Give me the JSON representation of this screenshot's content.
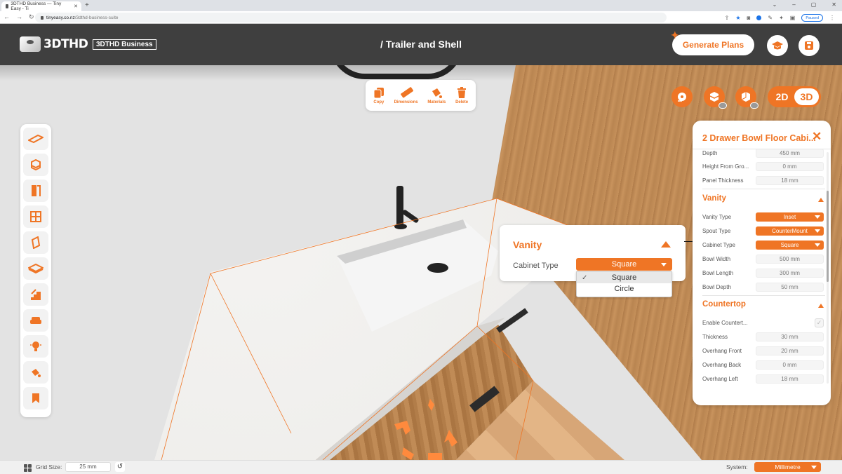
{
  "browser": {
    "tab_title": "3DTHD Business — Tiny Easy - Ti",
    "url_host": "tinyeasy.co.nz",
    "url_path": "/3dthd-business-suite",
    "profile_status": "Paused"
  },
  "header": {
    "logo_text": "3DTHD",
    "badge": "3DTHD Business",
    "page_title": "/ Trailer and Shell",
    "generate_plans": "Generate Plans"
  },
  "object_toolbar": [
    {
      "label": "Copy",
      "icon": "copy-icon"
    },
    {
      "label": "Dimensions",
      "icon": "ruler-icon"
    },
    {
      "label": "Materials",
      "icon": "paint-bucket-icon"
    },
    {
      "label": "Delete",
      "icon": "trash-icon"
    }
  ],
  "view_toggle": {
    "option_2d": "2D",
    "option_3d": "3D",
    "active": "3D"
  },
  "left_toolbar": [
    "floor-icon",
    "cube-icon",
    "door-icon",
    "window-icon",
    "wall-panel-icon",
    "slab-icon",
    "stairs-icon",
    "sofa-icon",
    "lightbulb-icon",
    "paint-bucket-icon",
    "bookmark-icon"
  ],
  "vanity_popup": {
    "title": "Vanity",
    "label": "Cabinet Type",
    "selected": "Square",
    "options": [
      "Square",
      "Circle"
    ]
  },
  "panel": {
    "title": "2 Drawer Bowl Floor Cabi...",
    "top_rows": [
      {
        "label": "Depth",
        "value": "450 mm"
      },
      {
        "label": "Height From Gro...",
        "value": "0 mm"
      },
      {
        "label": "Panel Thickness",
        "value": "18 mm"
      }
    ],
    "vanity": {
      "title": "Vanity",
      "selects": [
        {
          "label": "Vanity Type",
          "value": "Inset"
        },
        {
          "label": "Spout Type",
          "value": "CounterMount"
        },
        {
          "label": "Cabinet Type",
          "value": "Square"
        }
      ],
      "rows": [
        {
          "label": "Bowl Width",
          "value": "500 mm"
        },
        {
          "label": "Bowl Length",
          "value": "300 mm"
        },
        {
          "label": "Bowl Depth",
          "value": "50 mm"
        }
      ]
    },
    "countertop": {
      "title": "Countertop",
      "enable_label": "Enable Countert...",
      "enabled": true,
      "rows": [
        {
          "label": "Thickness",
          "value": "30 mm"
        },
        {
          "label": "Overhang Front",
          "value": "20 mm"
        },
        {
          "label": "Overhang Back",
          "value": "0 mm"
        },
        {
          "label": "Overhang Left",
          "value": "18 mm"
        }
      ]
    }
  },
  "statusbar": {
    "grid_label": "Grid Size:",
    "grid_value": "25 mm",
    "system_label": "System:",
    "system_value": "Millimetre"
  },
  "colors": {
    "accent": "#ef7525",
    "header_bg": "#3f3f3f"
  }
}
